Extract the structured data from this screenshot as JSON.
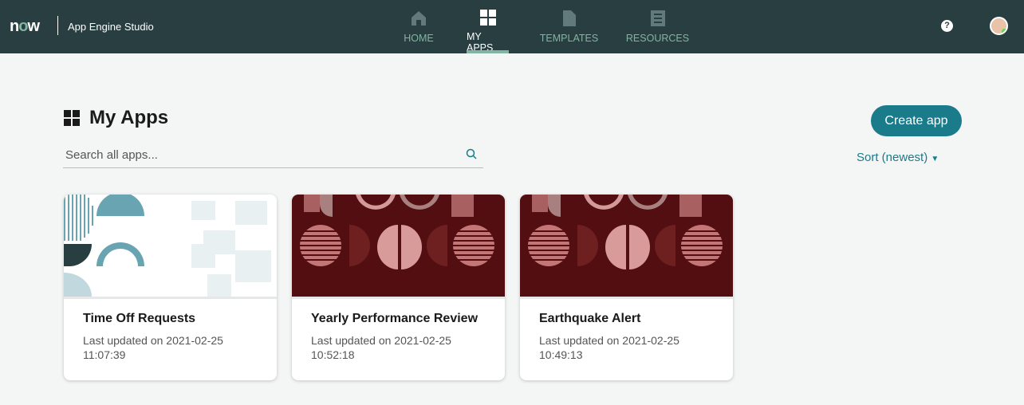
{
  "header": {
    "logo": "now",
    "app_name": "App Engine Studio",
    "help": "?",
    "nav": [
      {
        "label": "HOME",
        "icon": "home-icon"
      },
      {
        "label": "MY APPS",
        "icon": "grid-icon",
        "active": true
      },
      {
        "label": "TEMPLATES",
        "icon": "document-icon"
      },
      {
        "label": "RESOURCES",
        "icon": "book-icon"
      }
    ]
  },
  "page": {
    "title": "My Apps",
    "search_placeholder": "Search all apps...",
    "create_label": "Create app",
    "sort_label": "Sort (newest)"
  },
  "apps": [
    {
      "name": "Time Off Requests",
      "updated_label": "Last updated on 2021-02-25",
      "updated_time": "11:07:39"
    },
    {
      "name": "Yearly Performance Review",
      "updated_label": "Last updated on 2021-02-25",
      "updated_time": "10:52:18"
    },
    {
      "name": "Earthquake Alert",
      "updated_label": "Last updated on 2021-02-25",
      "updated_time": "10:49:13"
    }
  ],
  "colors": {
    "header": "#293e40",
    "accent": "#1a7b8a",
    "nav_accent": "#81b5a1"
  }
}
